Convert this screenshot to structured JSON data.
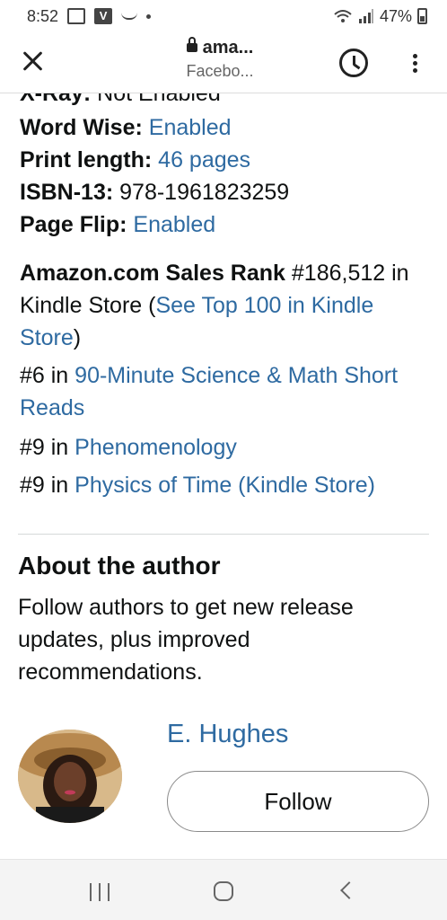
{
  "status": {
    "time": "8:52",
    "battery": "47%"
  },
  "browser": {
    "domain": "ama...",
    "page_title": "Facebo..."
  },
  "details": {
    "xray_label": "X-Ray:",
    "xray_value": "Not Enabled",
    "wordwise_label": "Word Wise:",
    "wordwise_value": "Enabled",
    "print_label": "Print length:",
    "print_value": "46 pages",
    "isbn_label": "ISBN-13:",
    "isbn_value": "978-1961823259",
    "pageflip_label": "Page Flip:",
    "pageflip_value": "Enabled"
  },
  "sales_rank": {
    "label": "Amazon.com Sales Rank",
    "value": "#186,512",
    "store_text": "in Kindle Store (",
    "top100_link": "See Top 100 in Kindle Store",
    "close_paren": ")",
    "categories": [
      {
        "rank": "#6 in",
        "name": "90-Minute Science & Math Short Reads"
      },
      {
        "rank": "#9 in",
        "name": "Phenomenology"
      },
      {
        "rank": "#9 in",
        "name": "Physics of Time (Kindle Store)"
      }
    ]
  },
  "about": {
    "title": "About the author",
    "description": "Follow authors to get new release updates, plus improved recommendations."
  },
  "author": {
    "name": "E. Hughes",
    "follow_label": "Follow"
  }
}
